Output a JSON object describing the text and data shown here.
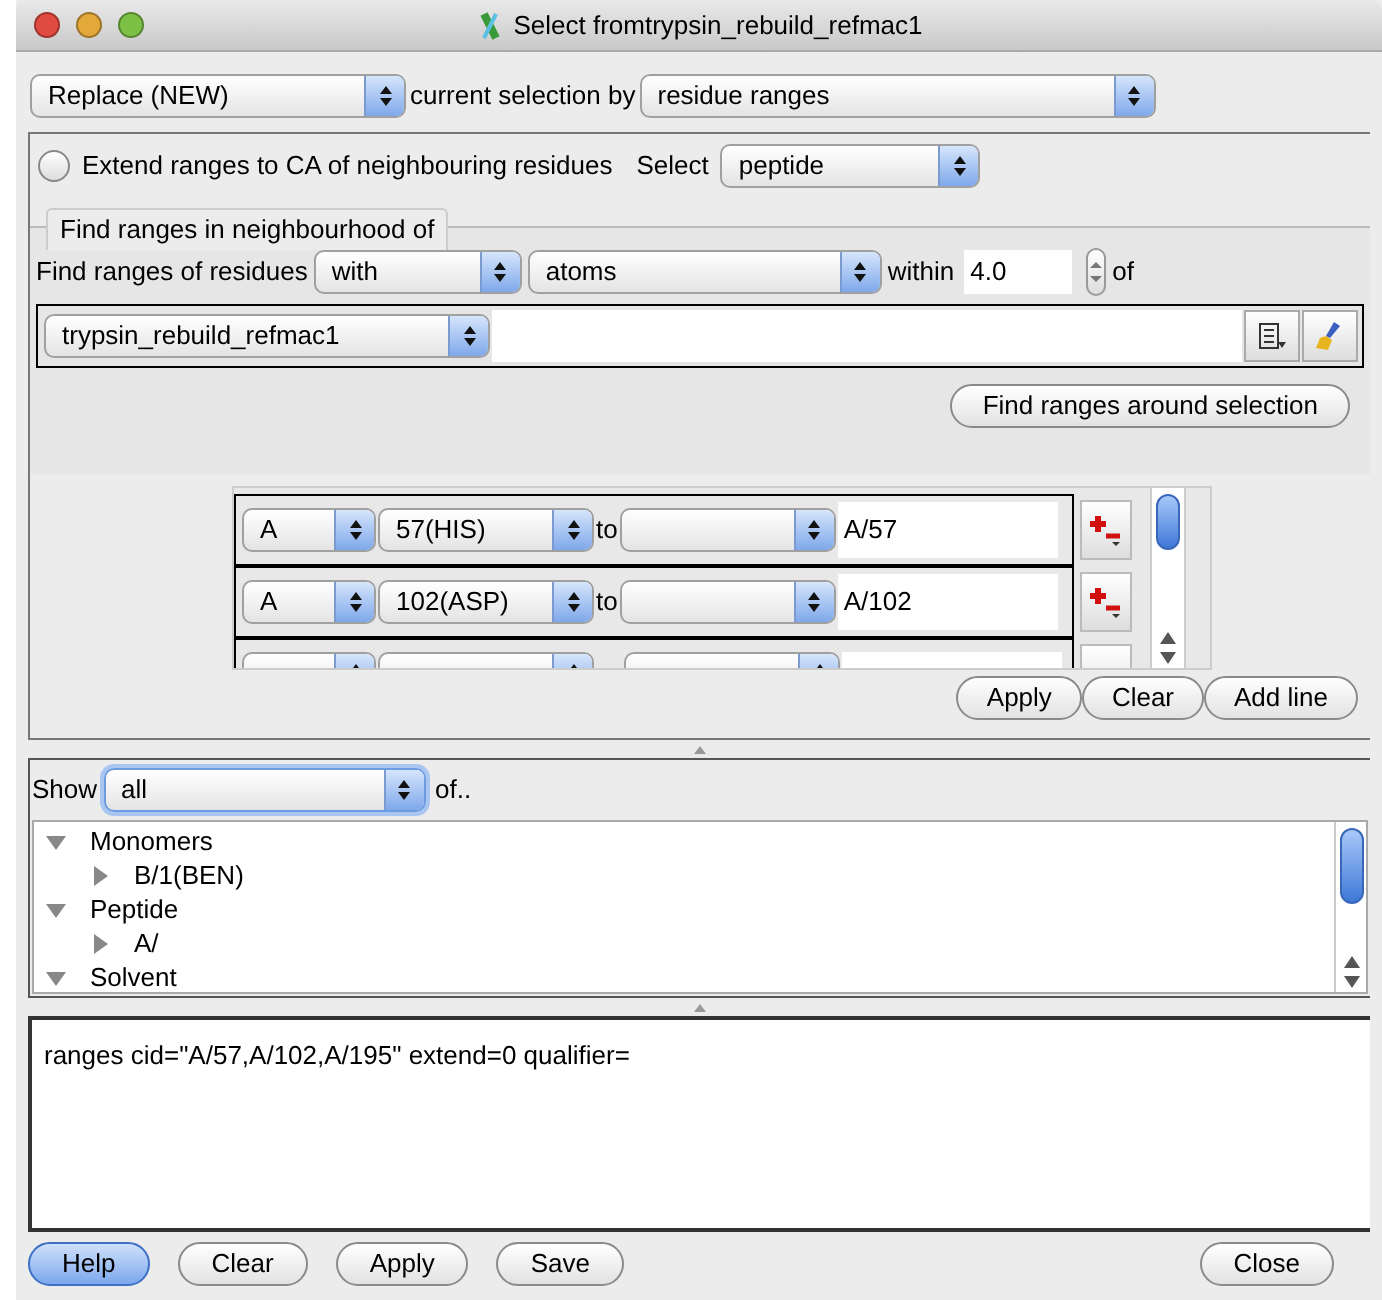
{
  "window": {
    "title": "Select fromtrypsin_rebuild_refmac1"
  },
  "mode_select": {
    "value": "Replace (NEW)"
  },
  "mode_label": "current selection by",
  "by_select": {
    "value": "residue ranges"
  },
  "extend": {
    "label": "Extend ranges to CA of neighbouring residues",
    "checked": false
  },
  "select_label": "Select",
  "select_type": {
    "value": "peptide"
  },
  "neighbourhood": {
    "title": "Find ranges in neighbourhood of",
    "label": "Find ranges of residues",
    "with": "with",
    "atoms": "atoms",
    "within_label": "within",
    "distance": "4.0",
    "of_label": "of",
    "molecule": "trypsin_rebuild_refmac1",
    "find_button": "Find ranges around selection"
  },
  "ranges": [
    {
      "kind": "row",
      "chain": "A",
      "from": "57(HIS)",
      "to_label": "to",
      "cid": "A/57"
    },
    {
      "kind": "row",
      "chain": "A",
      "from": "102(ASP)",
      "to_label": "to",
      "cid": "A/102"
    },
    {
      "kind": "clipped"
    }
  ],
  "range_buttons": [
    "Apply",
    "Clear",
    "Add line"
  ],
  "show": {
    "label": "Show",
    "value": "all",
    "suffix": "of..",
    "tree": [
      {
        "label": "Monomers",
        "expanded": true,
        "children": [
          {
            "label": "B/1(BEN)",
            "expanded": false
          }
        ]
      },
      {
        "label": "Peptide",
        "expanded": true,
        "children": [
          {
            "label": "A/",
            "expanded": false
          }
        ]
      },
      {
        "label": "Solvent",
        "expanded": true
      }
    ]
  },
  "command": "ranges cid=\"A/57,A/102,A/195\" extend=0 qualifier=",
  "buttons": [
    {
      "label": "Help",
      "default": true
    },
    {
      "label": "Clear",
      "default": false
    },
    {
      "label": "Apply",
      "default": false
    },
    {
      "label": "Save",
      "default": false
    },
    {
      "label": "Close",
      "default": false
    }
  ]
}
